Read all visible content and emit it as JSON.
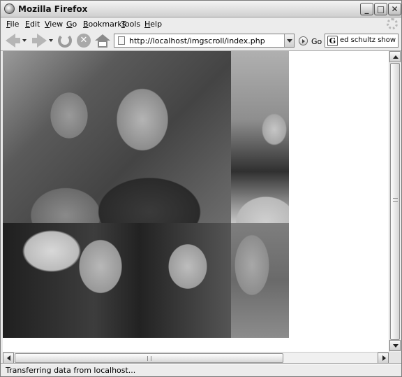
{
  "window": {
    "title": "Mozilla Firefox",
    "controls": {
      "minimize": "_",
      "maximize": "□",
      "close": "✕"
    }
  },
  "menubar": {
    "items": [
      {
        "label": "File",
        "accel": "F",
        "rest": "ile"
      },
      {
        "label": "Edit",
        "accel": "E",
        "rest": "dit"
      },
      {
        "label": "View",
        "accel": "V",
        "rest": "iew"
      },
      {
        "label": "Go",
        "accel": "G",
        "rest": "o"
      },
      {
        "label": "Bookmarks",
        "accel": "B",
        "rest": "ookmarks"
      },
      {
        "label": "Tools",
        "accel": "T",
        "rest": "ools"
      },
      {
        "label": "Help",
        "accel": "H",
        "rest": "elp"
      }
    ]
  },
  "toolbar": {
    "stop_glyph": "✕",
    "url": "http://localhost/imgscroll/index.php",
    "go_label": "Go",
    "search_engine_glyph": "G",
    "search_value": "ed schultz show"
  },
  "content": {
    "photos": [
      {
        "name": "photo-mother-and-baby"
      },
      {
        "name": "photo-baby-ear-closeup"
      },
      {
        "name": "photo-woman-and-baby-facing"
      },
      {
        "name": "photo-partial-edge"
      }
    ]
  },
  "statusbar": {
    "text": "Transferring data from localhost..."
  },
  "colors": {
    "chrome": "#ececec",
    "content_background": "#ffffff"
  }
}
